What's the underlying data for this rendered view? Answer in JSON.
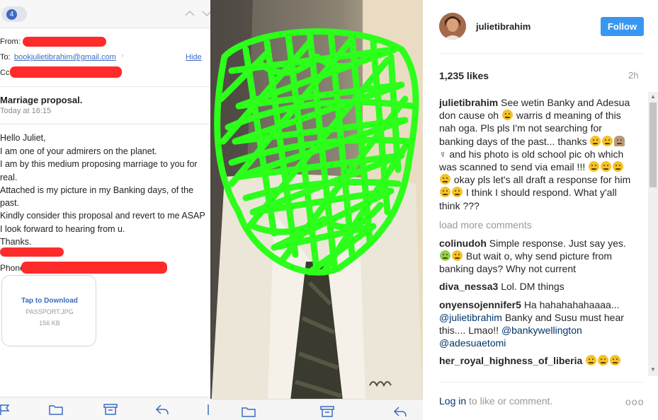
{
  "email": {
    "unread_count": "4",
    "from_label": "From:",
    "to_label": "To:",
    "to_address": "bookjulietibrahim@gmail.com",
    "hide_link": "Hide",
    "cc_label": "Cc:",
    "subject": "Marriage proposal.",
    "date": "Today at 16:15",
    "body_lines": [
      "Hello Juliet,",
      "I am one of your admirers on the planet.",
      "I am by this medium proposing marriage to you for",
      "real.",
      "Attached is my picture in my Banking days, of the",
      "past.",
      "Kindly consider this proposal and revert to me ASAP",
      "I look forward to hearing from u.",
      "Thanks."
    ],
    "phones_label": "Phones:",
    "attachment": {
      "action": "Tap to Download",
      "filename": "PASSPORT.JPG",
      "size": "156 KB"
    },
    "toolbar_icons": [
      "flag-icon",
      "folder-icon",
      "archive-icon",
      "reply-icon",
      "compose-icon"
    ]
  },
  "photo": {
    "toolbar_icons": [
      "folder-icon",
      "archive-icon",
      "reply-icon"
    ]
  },
  "instagram": {
    "username": "julietibrahim",
    "follow_label": "Follow",
    "likes": "1,235 likes",
    "time": "2h",
    "caption": {
      "user": "julietibrahim",
      "part1": "See wetin Banky and Adesua don cause oh",
      "part2": "warris d meaning of this nah oga. Pls pls I'm not searching for banking days of the past... thanks",
      "part3": "and his photo is old school pic oh which was scanned to send via email !!!",
      "part4": "okay pls let's all draft a response for him",
      "part5": "I think I should respond. What y'all think ???"
    },
    "load_more": "load more comments",
    "comments": [
      {
        "user": "colinudoh",
        "text1": "Simple response. Just say yes.",
        "text2": "But wait o, why send picture from banking days? Why not current"
      },
      {
        "user": "diva_nessa3",
        "text1": "Lol. DM things"
      },
      {
        "user": "onyensojennifer5",
        "text1": "Ha hahahahahaaaa...",
        "mention1": "@julietibrahim",
        "text2": "Banky and Susu must hear this.... Lmao!!",
        "mention2": "@bankywellington",
        "mention3": "@adesuaetomi"
      },
      {
        "user": "her_royal_highness_of_liberia"
      }
    ],
    "login_link": "Log in",
    "login_rest": "to like or comment.",
    "more_label": "ooo"
  }
}
